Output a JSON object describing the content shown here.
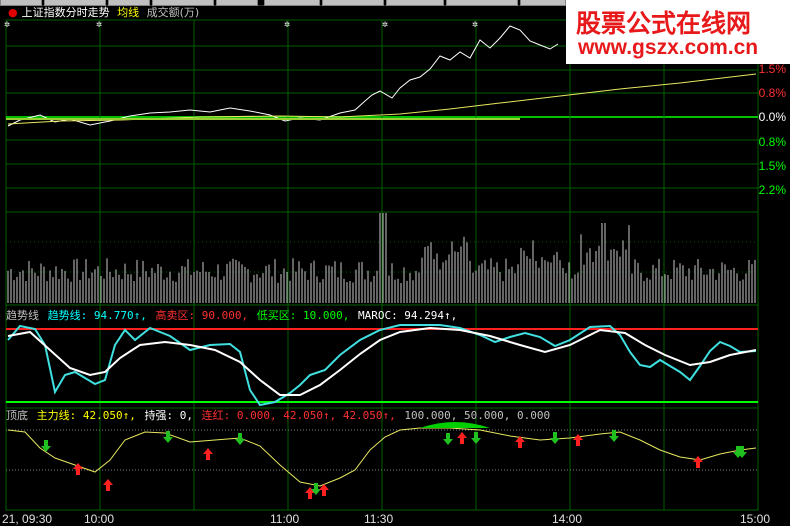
{
  "header": {
    "title": "上证指数分时走势",
    "ma_label": "均线",
    "volume_label": "成交额(万)"
  },
  "price_axis": {
    "labels_pos": [
      "1.5%",
      "0.8%"
    ],
    "label_zero": "0.0%",
    "labels_neg": [
      "0.8%",
      "1.5%",
      "2.2%"
    ]
  },
  "trend_indicator": {
    "name": "趋势线",
    "line_label": "趋势线: 94.770↑,",
    "high_label": "高卖区: 90.000,",
    "low_label": "低买区: 10.000,",
    "maroc_label": "MAROC: 94.294↑,"
  },
  "topbottom_indicator": {
    "name": "顶底",
    "main_label": "主力线: 42.050↑,",
    "strong_label": "持强: 0,",
    "red_label": "连红: 0.000, 42.050↑, 42.050↑,",
    "extra_label": "100.000, 50.000, 0.000"
  },
  "time_axis": [
    "21, 09:30",
    "10:00",
    "11:00",
    "11:30",
    "14:00",
    "15:00"
  ],
  "watermark": {
    "line1": "股票公式在线网",
    "line2": "www.gszx.com.cn"
  },
  "colors": {
    "background": "#000000",
    "grid": "#006000",
    "price_line": "#ffffff",
    "avg_line": "#ffff00",
    "trend_cyan": "#40e0e0",
    "arrow_up": "#ff2020",
    "arrow_down": "#20c020",
    "watermark_red": "#e8191b"
  }
}
